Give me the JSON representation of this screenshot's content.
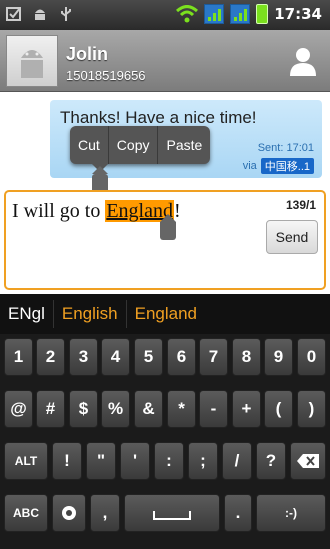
{
  "status_bar": {
    "time": "17:34"
  },
  "contact": {
    "name": "Jolin",
    "number": "15018519656"
  },
  "message": {
    "text": "Thanks! Have a nice time!",
    "sent": "Sent: 17:01",
    "via_label": "via",
    "via_carrier": "中国移..1"
  },
  "edit_menu": {
    "items": [
      "Cut",
      "Copy",
      "Paste"
    ]
  },
  "compose": {
    "before": "I will go to ",
    "selected": "England",
    "after": "!",
    "counter": "139/1",
    "send_label": "Send"
  },
  "suggestions": [
    "ENgl",
    "English",
    "England"
  ],
  "keyboard": {
    "row1": [
      "1",
      "2",
      "3",
      "4",
      "5",
      "6",
      "7",
      "8",
      "9",
      "0"
    ],
    "row2": [
      "@",
      "#",
      "$",
      "%",
      "&",
      "*",
      "-",
      "+",
      "(",
      ")"
    ],
    "row3": [
      "ALT",
      "!",
      "\"",
      "'",
      ":",
      ";",
      "/",
      "?"
    ],
    "row4": [
      "ABC",
      ",",
      "",
      ".",
      ":-)"
    ]
  },
  "colors": {
    "accent": "#f0a022",
    "bubble": "#b7def7",
    "keyboard_bg": "#1b1b1b"
  }
}
